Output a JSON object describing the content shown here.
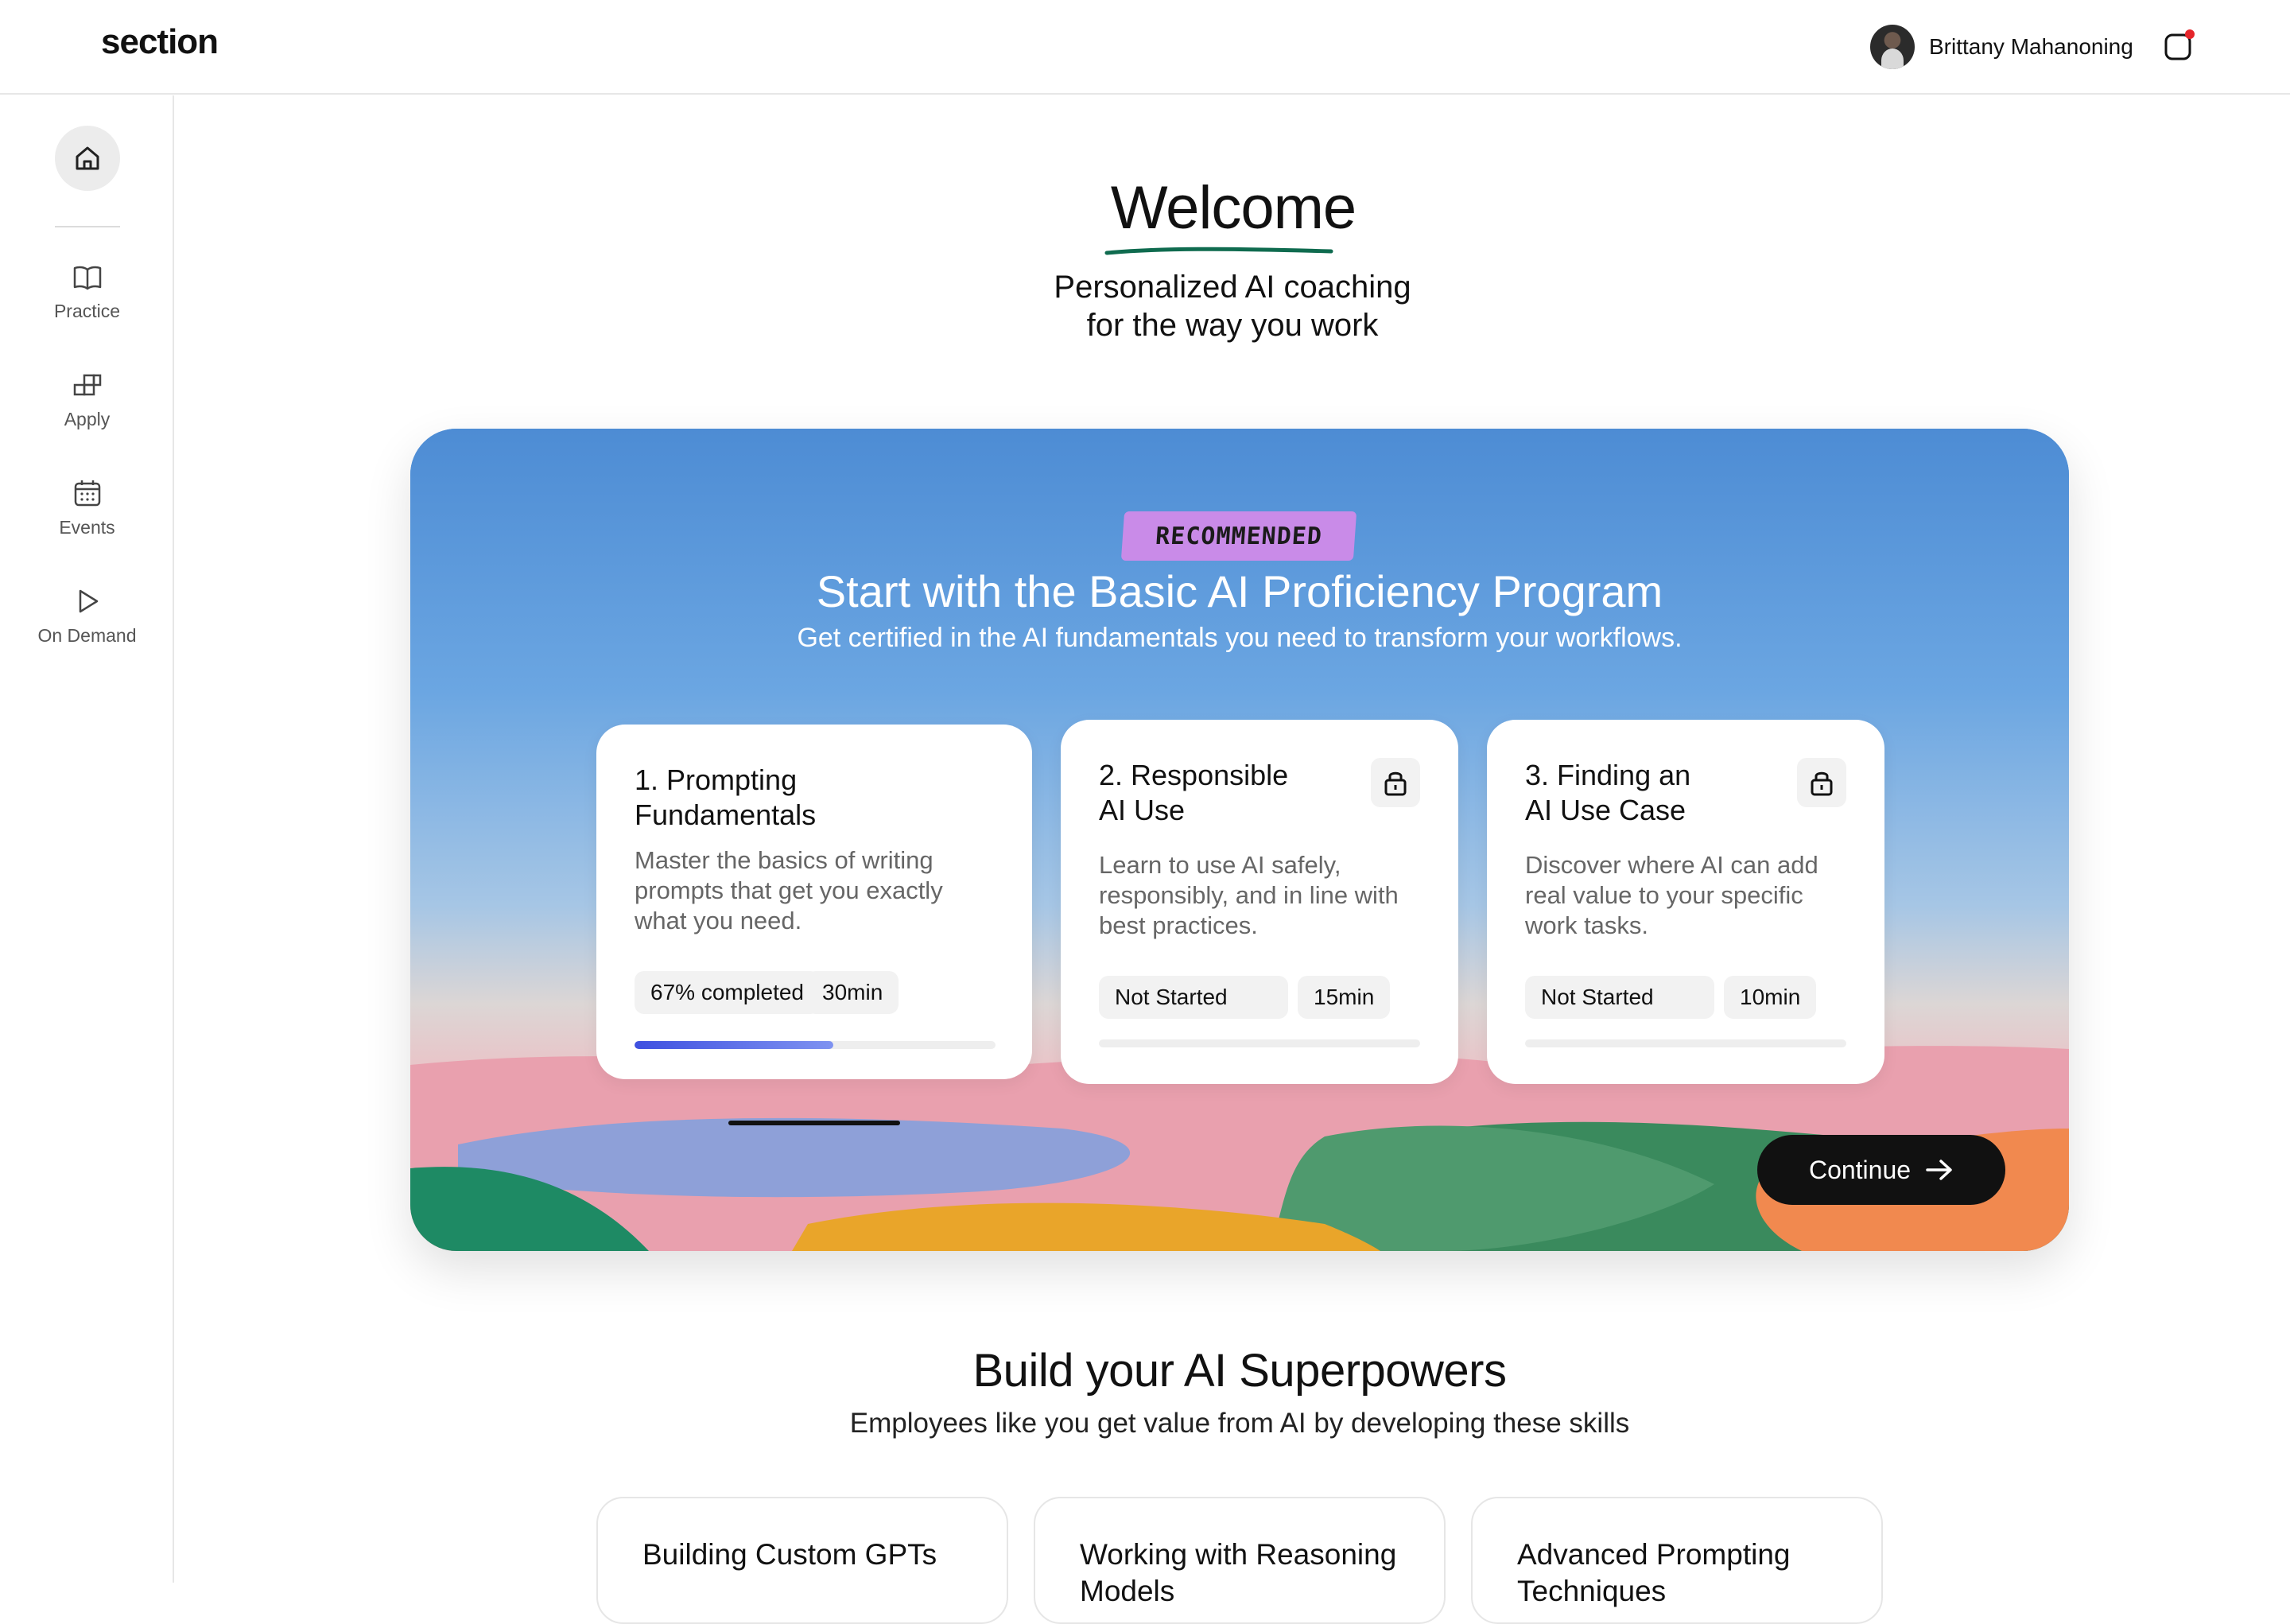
{
  "app": {
    "logo": "section"
  },
  "user": {
    "name": "Brittany Mahanoning"
  },
  "sidebar": {
    "items": [
      {
        "label": "Practice",
        "icon": "book-icon"
      },
      {
        "label": "Apply",
        "icon": "blocks-icon"
      },
      {
        "label": "Events",
        "icon": "calendar-icon"
      },
      {
        "label": "On Demand",
        "icon": "play-icon"
      }
    ]
  },
  "welcome": {
    "title": "Welcome",
    "tagline_line1": "Personalized AI coaching",
    "tagline_line2": "for the way you work"
  },
  "hero": {
    "badge": "RECOMMENDED",
    "title": "Start with the Basic AI Proficiency Program",
    "subtitle": "Get certified in the AI fundamentals you need to transform your workflows.",
    "continue_label": "Continue",
    "cards": [
      {
        "title_line1": "1. Prompting",
        "title_line2": "Fundamentals",
        "description": "Master the basics of writing prompts that get you exactly what you need.",
        "status": "67% completed",
        "duration": "30min",
        "progress": 0.55,
        "locked": false
      },
      {
        "title_line1": "2. Responsible",
        "title_line2": "AI Use",
        "description": "Learn to use AI safely, responsibly, and in line with best practices.",
        "status": "Not Started",
        "duration": "15min",
        "progress": 0,
        "locked": true
      },
      {
        "title_line1": "3. Finding an",
        "title_line2": "AI Use Case",
        "description": "Discover where AI can add real value to your specific work tasks.",
        "status": "Not Started",
        "duration": "10min",
        "progress": 0,
        "locked": true
      }
    ]
  },
  "skills": {
    "title": "Build your AI Superpowers",
    "subtitle": "Employees like you get value from AI by developing these skills",
    "cards": [
      {
        "title": "Building Custom GPTs"
      },
      {
        "title": "Working with Reasoning Models"
      },
      {
        "title": "Advanced Prompting Techniques"
      }
    ]
  },
  "colors": {
    "accent_progress": "#3e50e0",
    "badge": "#c98be8",
    "notification_dot": "#e5252a",
    "underline": "#0f6b4f"
  }
}
